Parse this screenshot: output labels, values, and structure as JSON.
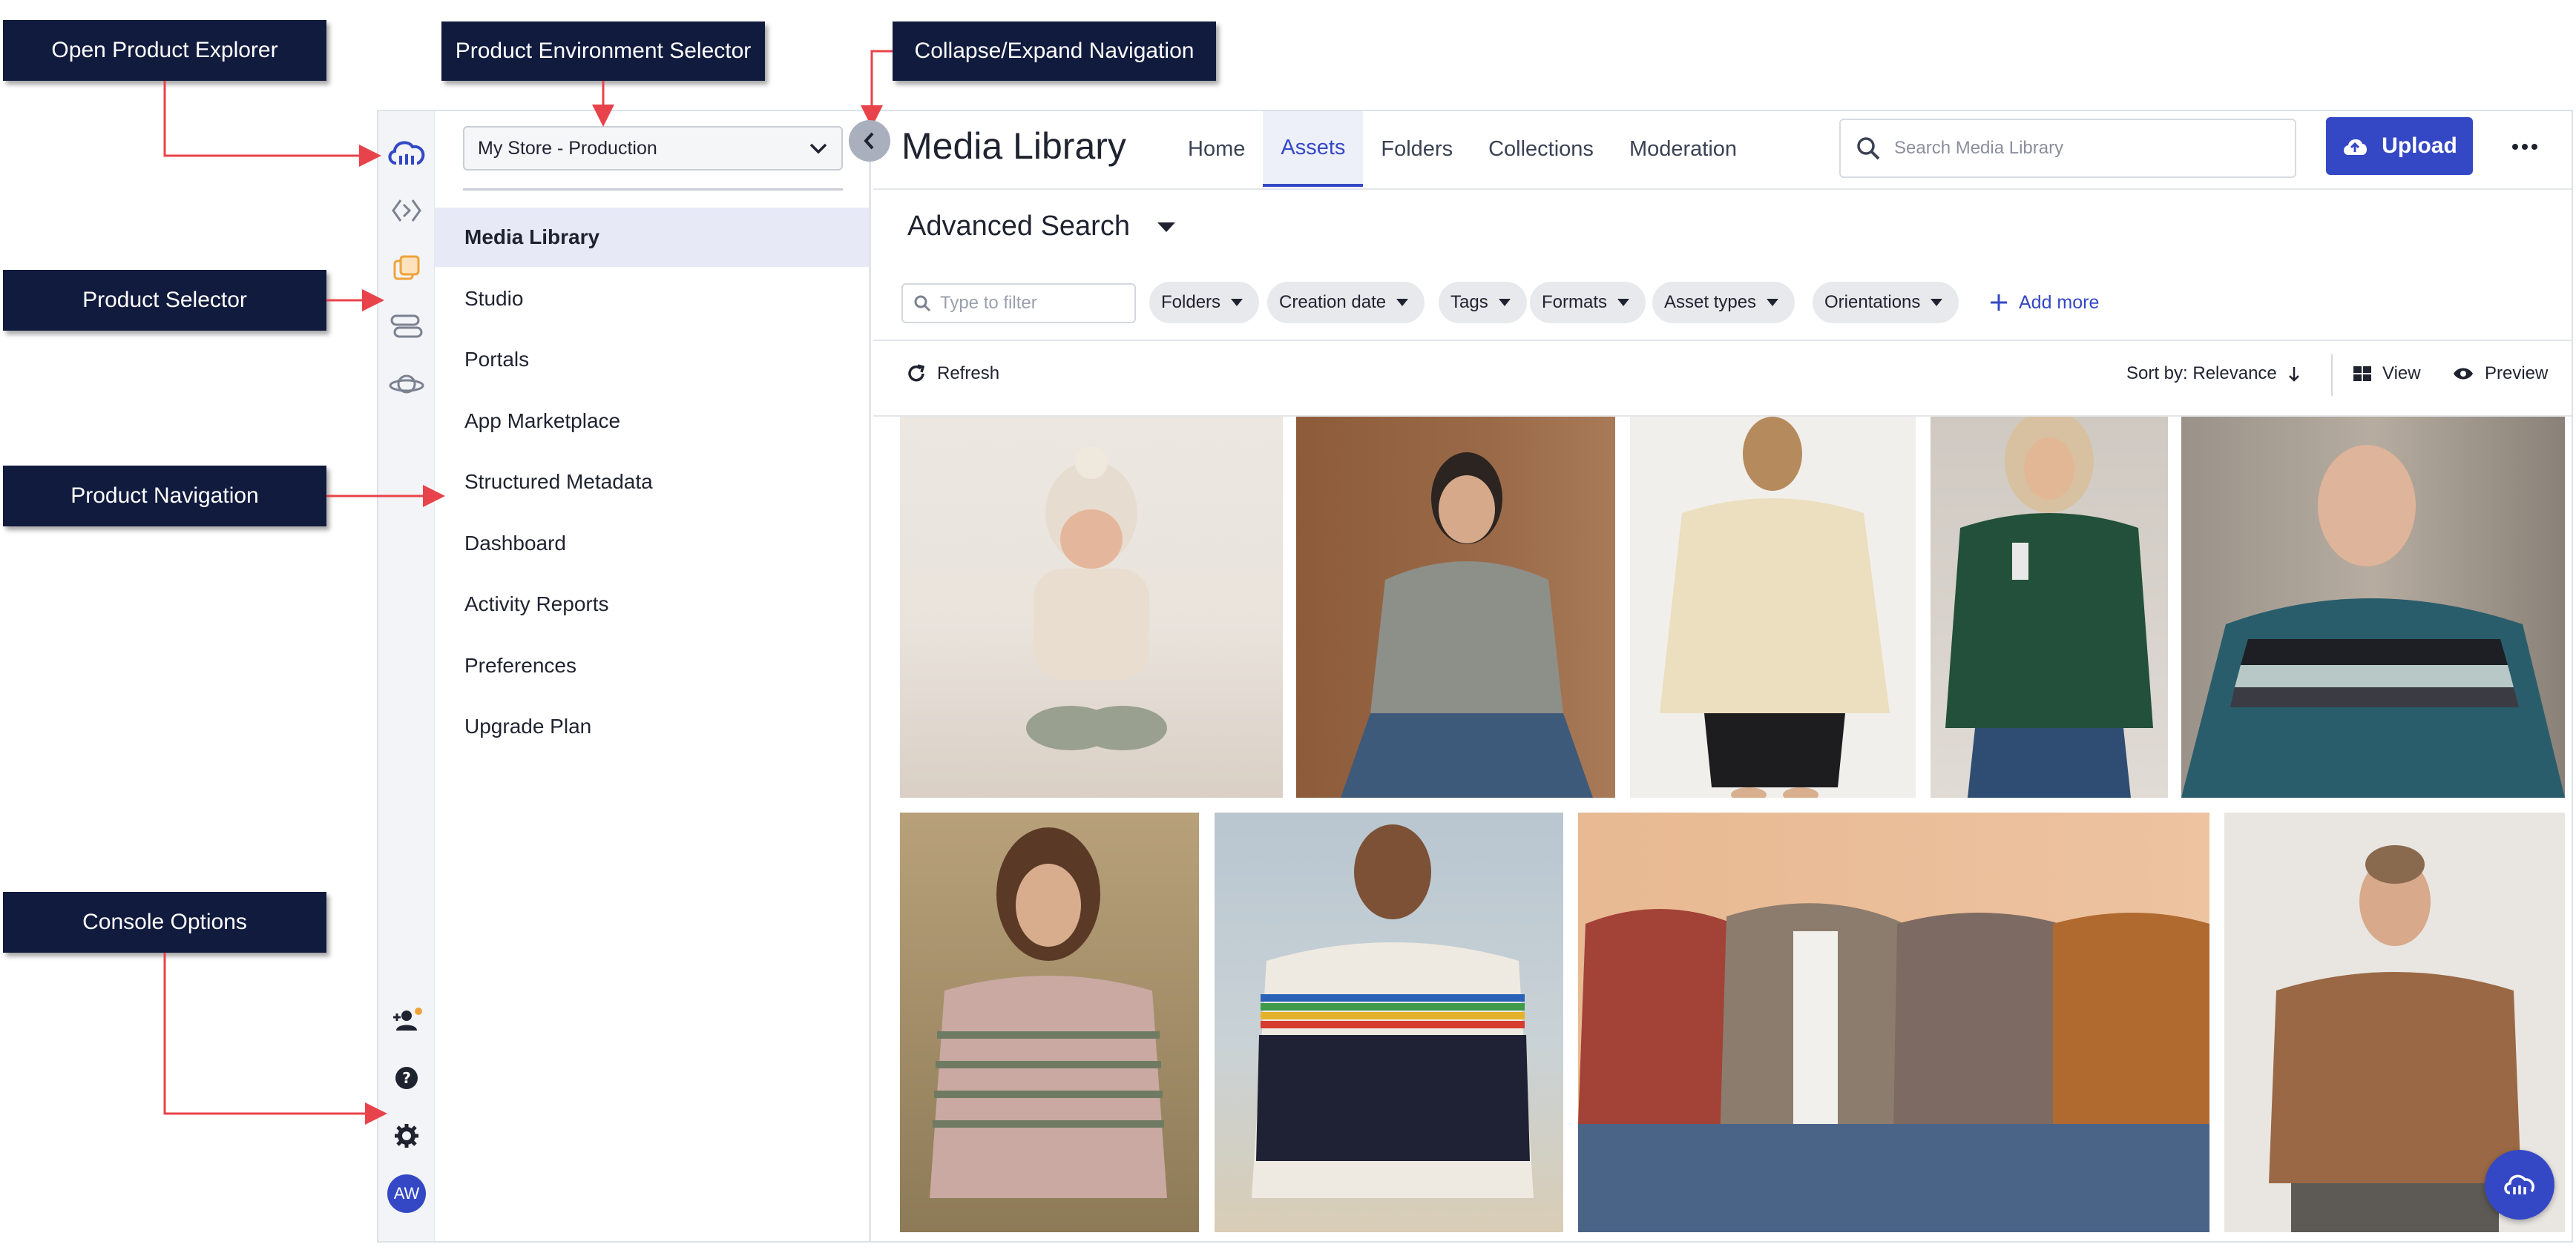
{
  "callouts": {
    "open_product_explorer": "Open Product Explorer",
    "product_environment_selector": "Product Environment Selector",
    "collapse_expand_navigation": "Collapse/Expand Navigation",
    "product_selector": "Product Selector",
    "product_navigation": "Product Navigation",
    "console_options": "Console Options"
  },
  "rail": {
    "icons": [
      "cloud-logo-icon",
      "code-brackets-icon",
      "layers-icon",
      "stack-icon",
      "planet-icon"
    ],
    "bottom_icons": [
      "invite-user-icon",
      "help-icon",
      "gear-icon"
    ],
    "avatar": "AW"
  },
  "nav": {
    "environment": "My Store - Production",
    "items": [
      {
        "label": "Media Library",
        "active": true
      },
      {
        "label": "Studio"
      },
      {
        "label": "Portals"
      },
      {
        "label": "App Marketplace"
      },
      {
        "label": "Structured Metadata"
      },
      {
        "label": "Dashboard"
      },
      {
        "label": "Activity Reports"
      },
      {
        "label": "Preferences"
      },
      {
        "label": "Upgrade Plan"
      }
    ]
  },
  "header": {
    "title": "Media Library",
    "tabs": [
      {
        "label": "Home"
      },
      {
        "label": "Assets",
        "active": true
      },
      {
        "label": "Folders"
      },
      {
        "label": "Collections"
      },
      {
        "label": "Moderation"
      }
    ],
    "search_placeholder": "Search Media Library",
    "upload_label": "Upload"
  },
  "search": {
    "heading": "Advanced Search",
    "filter_placeholder": "Type to filter",
    "chips": [
      "Folders",
      "Creation date",
      "Tags",
      "Formats",
      "Asset types",
      "Orientations"
    ],
    "add_more": "Add more"
  },
  "toolbar": {
    "refresh": "Refresh",
    "sort": "Sort by: Relevance",
    "view": "View",
    "preview": "Preview"
  },
  "assets": [
    "baby-in-knit-hat-photo",
    "woman-grey-sweater-photo",
    "woman-cream-pullover-photo",
    "woman-green-cable-knit-photo",
    "man-striped-sweater-photo",
    "woman-fairisle-sweater-photo",
    "man-rainbow-stripe-sweater-photo",
    "group-cardigans-photo",
    "woman-brown-sweater-photo"
  ],
  "colors": {
    "accent": "#3448c5",
    "callout_bg": "#111b3e",
    "arrow": "#e8434a"
  }
}
